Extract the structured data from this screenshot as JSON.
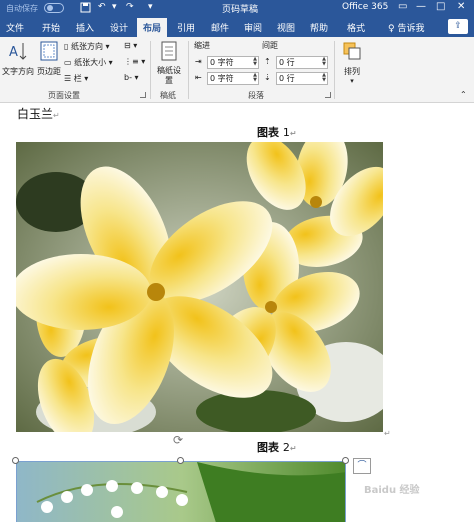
{
  "titlebar": {
    "autosave": "自动保存",
    "doc_title": "页码草稿",
    "app_name": "Office 365",
    "minimize": "—",
    "maximize": "□",
    "close": "✕"
  },
  "tabs": [
    "文件",
    "开始",
    "插入",
    "设计",
    "布局",
    "引用",
    "邮件",
    "审阅",
    "视图",
    "帮助",
    "格式"
  ],
  "active_tab": "布局",
  "tell_me": "告诉我",
  "ribbon": {
    "page_setup": {
      "text_direction": "文字方向",
      "margins": "页边距",
      "orientation": "纸张方向",
      "size": "纸张大小",
      "columns": "栏",
      "label": "页面设置"
    },
    "draft": {
      "draft_paper_settings": "稿纸设置",
      "label": "稿纸"
    },
    "paragraph": {
      "indent_label": "缩进",
      "spacing_label": "间距",
      "indent_left": "0 字符",
      "indent_right": "0 字符",
      "spacing_before": "0 行",
      "spacing_after": "0 行",
      "label": "段落"
    },
    "arrange": {
      "label": "排列"
    }
  },
  "document": {
    "paragraph_text": "白玉兰",
    "caption1_label": "图表",
    "caption1_num": "1",
    "caption2_label": "图表",
    "caption2_num": "2",
    "paragraph_mark": "↵",
    "watermark": "Baidu 经验"
  },
  "colors": {
    "brand": "#2b579a",
    "ribbon_bg": "#f3f3f3"
  }
}
